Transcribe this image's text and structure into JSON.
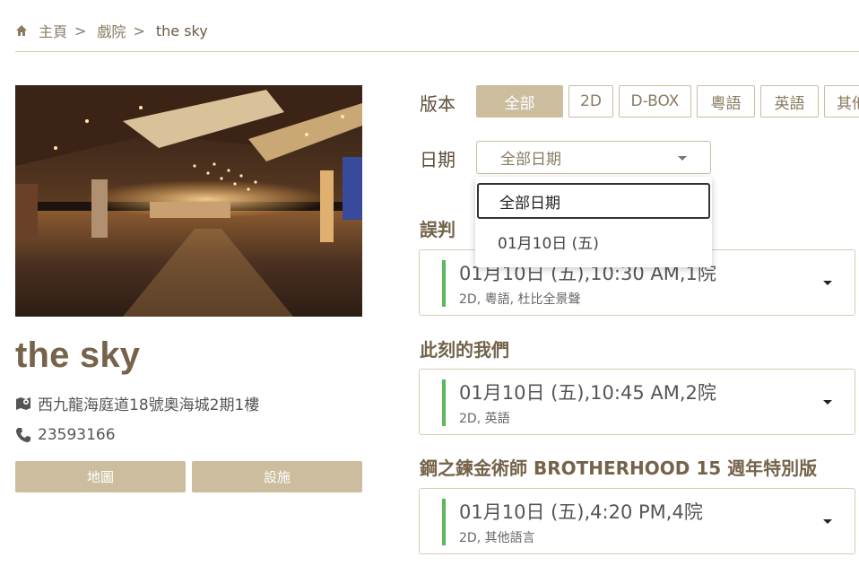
{
  "breadcrumb": {
    "home": "主頁",
    "sep": ">",
    "cinemas": "戲院",
    "current": "the sky"
  },
  "cinema": {
    "name": "the sky",
    "address": "西九龍海庭道18號奧海城2期1樓",
    "phone": "23593166",
    "map_button": "地圖",
    "facilities_button": "設施"
  },
  "filters": {
    "version_label": "版本",
    "date_label": "日期",
    "version_chips": [
      "全部",
      "2D",
      "D-BOX",
      "粵語",
      "英語",
      "其他"
    ],
    "active_chip": "全部",
    "date_select_value": "全部日期",
    "date_options": [
      "全部日期",
      "01月10日 (五)"
    ]
  },
  "movies": [
    {
      "title": "誤判",
      "time": "01月10日 (五),10:30 AM,1院",
      "sub": "2D, 粵語, 杜比全景聲"
    },
    {
      "title": "此刻的我們",
      "time": "01月10日 (五),10:45 AM,2院",
      "sub": "2D, 英語"
    },
    {
      "title": "鋼之鍊金術師 BROTHERHOOD 15 週年特別版",
      "time": "01月10日 (五),4:20 PM,4院",
      "sub": "2D, 其他語言"
    }
  ],
  "colors": {
    "accent": "#cbbd9e",
    "title": "#75634a",
    "showtime_bar": "#5cb85c"
  },
  "icons": [
    "home-icon",
    "map-location-icon",
    "phone-icon",
    "chevron-down-icon"
  ]
}
